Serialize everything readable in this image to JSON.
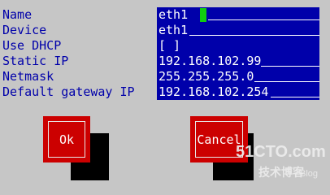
{
  "form": {
    "fields": [
      {
        "label": "Name",
        "value": "eth1"
      },
      {
        "label": "Device",
        "value": "eth1"
      },
      {
        "label": "Use DHCP",
        "value": "[ ]"
      },
      {
        "label": "Static IP",
        "value": "192.168.102.99"
      },
      {
        "label": "Netmask",
        "value": "255.255.255.0"
      },
      {
        "label": "Default gateway IP",
        "value": "192.168.102.254"
      }
    ]
  },
  "buttons": {
    "ok": "Ok",
    "cancel": "Cancel"
  },
  "watermark": {
    "brand": "51CTO.com",
    "tagline": "技术博客",
    "blog": "Blog"
  },
  "colors": {
    "background": "#c6c6c6",
    "label": "#0000aa",
    "field": "#0000aa",
    "cursor": "#11cc11",
    "button": "#cc0000",
    "button_shadow": "#000000"
  }
}
